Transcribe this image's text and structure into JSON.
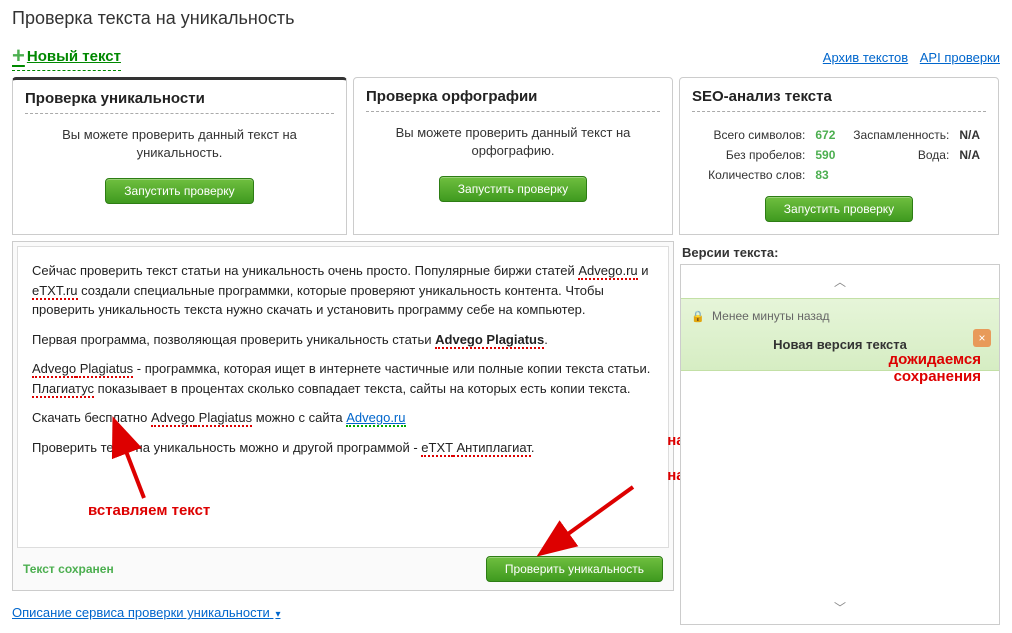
{
  "page_title": "Проверка текста на уникальность",
  "topbar": {
    "new_text": "Новый текст",
    "archive": "Архив текстов",
    "api": "API проверки"
  },
  "tabs": {
    "unique": {
      "title": "Проверка уникальности",
      "desc": "Вы можете проверить данный текст на уникальность.",
      "button": "Запустить проверку"
    },
    "spell": {
      "title": "Проверка орфографии",
      "desc": "Вы можете проверить данный текст на орфографию.",
      "button": "Запустить проверку"
    },
    "seo": {
      "title": "SEO-анализ текста",
      "rows": [
        {
          "label": "Всего символов:",
          "value": "672",
          "label2": "Заспамленность:",
          "value2": "N/A"
        },
        {
          "label": "Без пробелов:",
          "value": "590",
          "label2": "Вода:",
          "value2": "N/A"
        },
        {
          "label": "Количество слов:",
          "value": "83",
          "label2": "",
          "value2": ""
        }
      ],
      "button": "Запустить проверку"
    }
  },
  "editor": {
    "p1a": "Сейчас проверить текст статьи на уникальность очень просто.  Популярные биржи статей ",
    "p1_adv": "Advego.ru",
    "p1b": " и ",
    "p1_etxt": "eTXT.ru",
    "p1c": " создали специальные программки, которые проверяют уникальность контента. Чтобы проверить уникальность текста нужно скачать и установить программу себе на компьютер.",
    "p2a": "Первая программа, позволяющая проверить уникальность статьи ",
    "p2_b": "Advego Plagiatus",
    "p2c": ".",
    "p3_adv": "Advego",
    "p3_plag": " Plagiatus",
    "p3a": " - программка, которая ищет  в интернете частичные или полные копии текста статьи. ",
    "p3_plag2": "Плагиатус",
    "p3b": " показывает в процентах сколько совпадает текста, сайты на которых есть копии текста.",
    "p4a": "Скачать бесплатно ",
    "p4_adv": "Advego",
    "p4_plag": " Plagiatus",
    "p4b": " можно с сайта ",
    "p4_link": "Advego.ru",
    "p5a": "Проверить текст на уникальность можно и другой программой - ",
    "p5_etxt": "eTXT",
    "p5_anti": " Антиплагиат",
    "p5b": "."
  },
  "footer": {
    "saved": "Текст сохранен",
    "check_btn": "Проверить уникальность"
  },
  "versions": {
    "title": "Версии текста:",
    "time": "Менее минуты назад",
    "label": "Новая версия текста"
  },
  "desc_link": "Описание сервиса проверки уникальности",
  "annotations": {
    "wait_save": "дожидаемся\nсохранения",
    "press_btn_1": "нажимаем",
    "press_btn_2": "на кнопку",
    "insert_text": "вставляем текст"
  }
}
